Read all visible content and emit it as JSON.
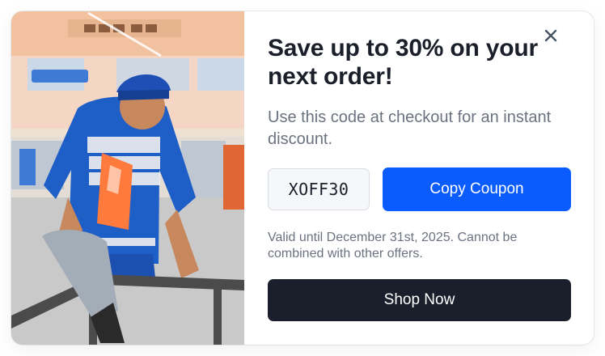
{
  "modal": {
    "image_alt": "Man in blue shirt sitting on railing",
    "headline": "Save up to 30% on your next order!",
    "subtitle": "Use this code at checkout for an instant discount.",
    "coupon_code": "XOFF30",
    "copy_button_label": "Copy Coupon",
    "validity_note": "Valid until December 31st, 2025. Cannot be combined with other offers.",
    "shop_button_label": "Shop Now",
    "close_icon": "close-icon",
    "colors": {
      "accent": "#0a5cff",
      "dark_button": "#1a1f2b",
      "heading": "#1b1f2a",
      "muted_text": "#6b7280"
    }
  }
}
